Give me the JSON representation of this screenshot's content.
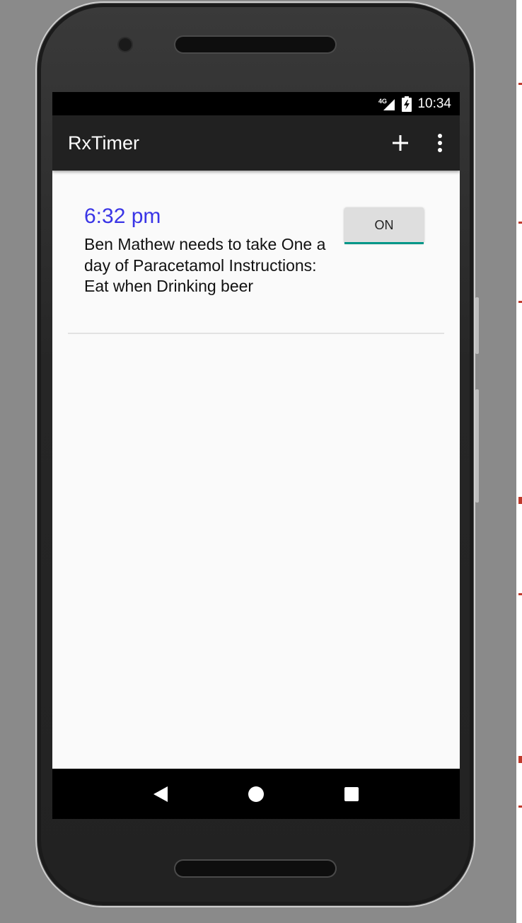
{
  "statusbar": {
    "network": "4G",
    "time": "10:34",
    "icons": [
      "signal-icon",
      "battery-charging-icon"
    ]
  },
  "appbar": {
    "title": "RxTimer",
    "actions": [
      "add-icon",
      "overflow-menu-icon"
    ]
  },
  "alarms": [
    {
      "time": "6:32 pm",
      "description": "Ben Mathew needs to take One a day of Paracetamol Instructions: Eat when Drinking beer",
      "toggle_label": "ON"
    }
  ],
  "navbar": {
    "buttons": [
      "back-icon",
      "home-icon",
      "recents-icon"
    ]
  },
  "colors": {
    "accent": "#009688",
    "time_text": "#3a35e6",
    "appbar": "#212121"
  }
}
